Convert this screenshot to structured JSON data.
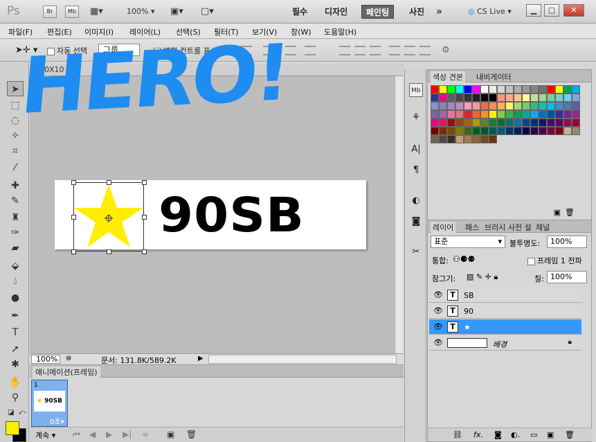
{
  "app": {
    "logo": "Ps",
    "bridge": "Br",
    "minibridge": "Mb",
    "zoom": "100%",
    "workspaces": [
      "필수",
      "디자인",
      "페인팅",
      "사진"
    ],
    "active_workspace": "페인팅",
    "more": "»",
    "cs_live": "CS Live"
  },
  "menu": [
    "파일(F)",
    "편집(E)",
    "이미지(I)",
    "레이어(L)",
    "선택(S)",
    "필터(T)",
    "보기(V)",
    "창(W)",
    "도움말(H)"
  ],
  "options": {
    "auto_select": "자동 선택",
    "group": "그룹",
    "show_transform": "변형 컨트롤 표시"
  },
  "document": {
    "tab_title": "50X10",
    "text": "90SB",
    "zoom": "100%",
    "doc_size": "문서: 131.8K/589.2K"
  },
  "animation": {
    "tab": "애니메이션(프레임)",
    "frame_number": "1",
    "frame_thumb_text": "90SB",
    "frame_delay": "0초",
    "loop": "계속"
  },
  "swatches": {
    "tabs": [
      "색상 견본",
      "내비게이터"
    ],
    "colors": [
      "#ff0000",
      "#ffff00",
      "#00ff00",
      "#00ffff",
      "#0000ff",
      "#ff00ff",
      "#ffffff",
      "#ebebeb",
      "#d6d6d6",
      "#c2c2c2",
      "#adadad",
      "#999999",
      "#858585",
      "#707070",
      "#ff0000",
      "#ffff00",
      "#00a550",
      "#00aeef",
      "#2e3192",
      "#ec008c",
      "#5c5c5c",
      "#474747",
      "#333333",
      "#1f1f1f",
      "#0a0a0a",
      "#000000",
      "#f7977a",
      "#f9ad81",
      "#fdc68a",
      "#fff79a",
      "#c4df9b",
      "#a3d39c",
      "#82ca9d",
      "#7bcdc8",
      "#6ecff6",
      "#7ea7d8",
      "#8493ca",
      "#8882be",
      "#a187be",
      "#bc8dbf",
      "#f49ac2",
      "#f6989d",
      "#f26c4f",
      "#f68e55",
      "#fbaf5c",
      "#fff467",
      "#acd372",
      "#7cc576",
      "#3bb878",
      "#1abbb4",
      "#00bff3",
      "#438ccb",
      "#5574b9",
      "#605ca8",
      "#855fa8",
      "#a763a8",
      "#f06eaa",
      "#f26d7d",
      "#ed1c24",
      "#f26522",
      "#f7941d",
      "#fff200",
      "#8dc63f",
      "#39b54a",
      "#00a651",
      "#00a99d",
      "#00aeef",
      "#0072bc",
      "#0054a6",
      "#2e3192",
      "#662d91",
      "#92278f",
      "#ec008c",
      "#ed145b",
      "#9e0b0f",
      "#a0410d",
      "#a3620a",
      "#aba000",
      "#598527",
      "#1a7b30",
      "#007236",
      "#00746b",
      "#0076a3",
      "#004b80",
      "#003471",
      "#1b1464",
      "#440e62",
      "#630460",
      "#9e005d",
      "#9e0039",
      "#790000",
      "#7b2e00",
      "#7d4900",
      "#827b00",
      "#406618",
      "#005e20",
      "#005826",
      "#005952",
      "#005b7f",
      "#003663",
      "#002157",
      "#0d004c",
      "#32004b",
      "#4b0049",
      "#7b0046",
      "#7a0026",
      "#c7b299",
      "#998675",
      "#736357",
      "#534741",
      "#37302a",
      "#c69c6d",
      "#a67c52",
      "#8c6239",
      "#754c24",
      "#603913"
    ]
  },
  "layers": {
    "tabs": [
      "레이어",
      "패스",
      "브러시 사전 설",
      "채널"
    ],
    "blend_mode": "표준",
    "opacity_label": "불투명도:",
    "opacity": "100%",
    "unify_label": "통합:",
    "frame1_label": "프레임 1 전파",
    "lock_label": "잠그기:",
    "fill_label": "칠:",
    "fill": "100%",
    "items": [
      {
        "name": "SB",
        "type": "T"
      },
      {
        "name": "90",
        "type": "T"
      },
      {
        "name": "★",
        "type": "T"
      },
      {
        "name": "배경",
        "type": "bg"
      }
    ]
  },
  "overlay": {
    "text": "HERO!"
  }
}
